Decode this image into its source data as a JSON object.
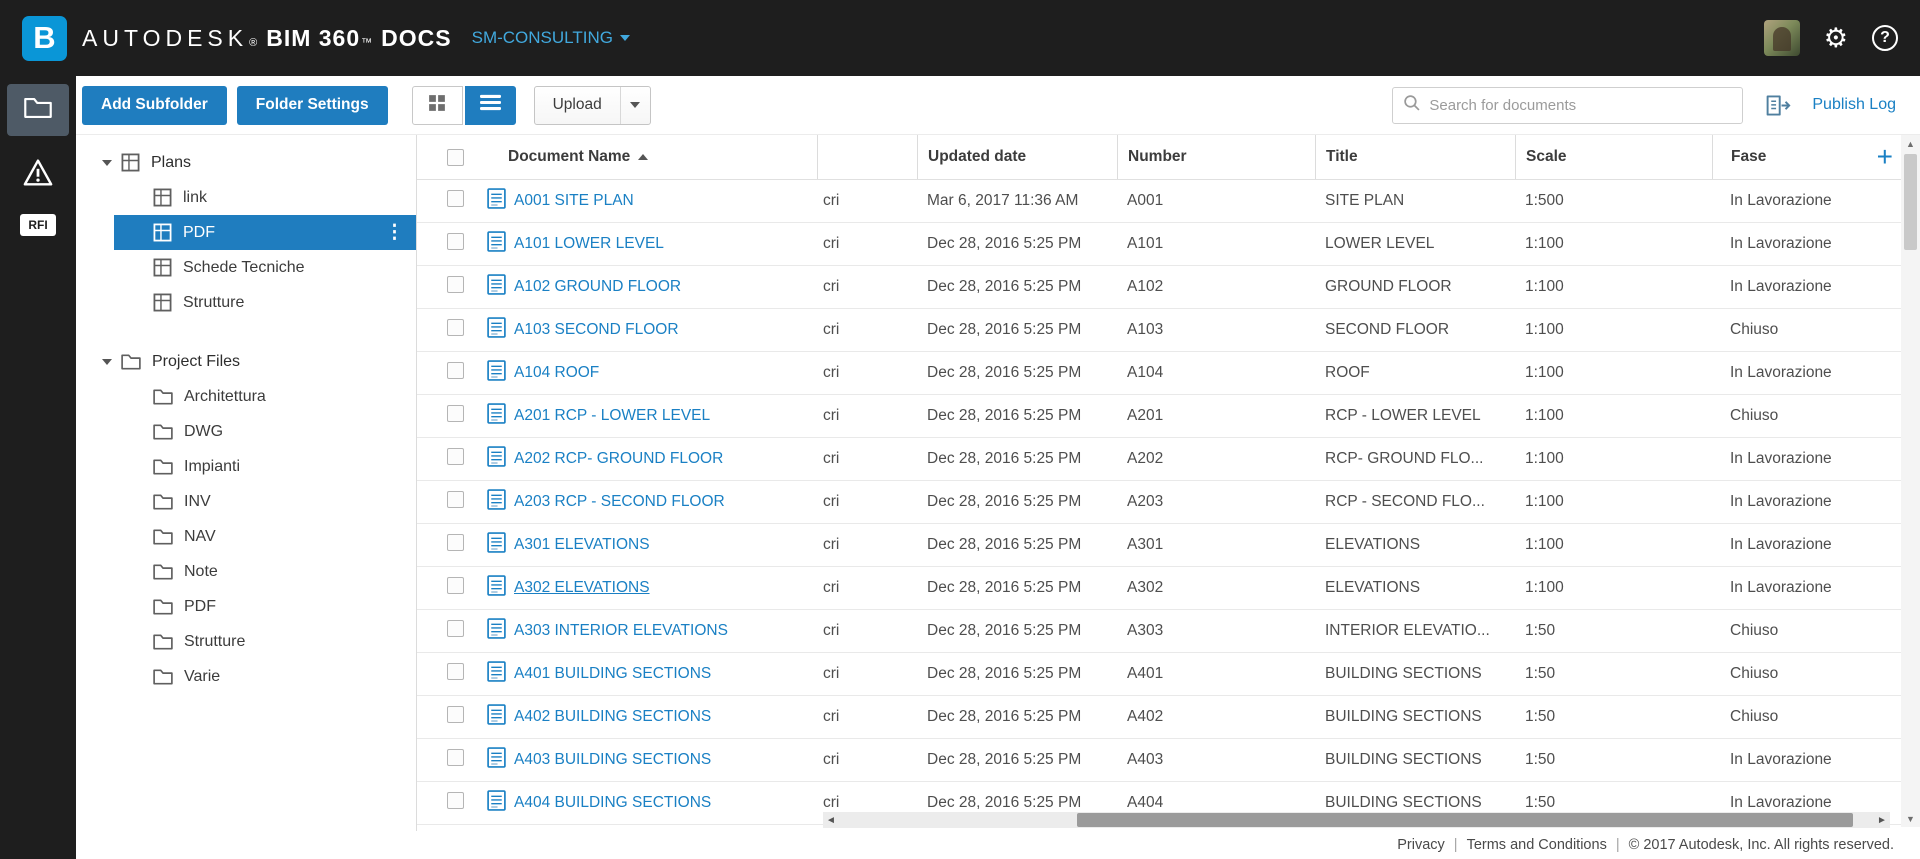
{
  "topbar": {
    "brand": {
      "logo_letter": "B",
      "autodesk": "AUTODESK",
      "reg": "®",
      "product": "BIM 360",
      "tm": "™",
      "docs": "DOCS"
    },
    "account_label": "SM-CONSULTING"
  },
  "rail": {
    "rfi_label": "RFI"
  },
  "toolbar": {
    "add_subfolder_label": "Add Subfolder",
    "folder_settings_label": "Folder Settings",
    "upload_label": "Upload",
    "search_placeholder": "Search for documents",
    "publish_log_label": "Publish Log"
  },
  "tree": {
    "sections": [
      {
        "label": "Plans",
        "icon": "sheet",
        "children": [
          {
            "label": "link"
          },
          {
            "label": "PDF",
            "selected": true
          },
          {
            "label": "Schede Tecniche"
          },
          {
            "label": "Strutture"
          }
        ]
      },
      {
        "label": "Project Files",
        "icon": "folder",
        "children": [
          {
            "label": "Architettura"
          },
          {
            "label": "DWG"
          },
          {
            "label": "Impianti"
          },
          {
            "label": "INV"
          },
          {
            "label": "NAV"
          },
          {
            "label": "Note"
          },
          {
            "label": "PDF"
          },
          {
            "label": "Strutture"
          },
          {
            "label": "Varie"
          }
        ]
      }
    ]
  },
  "table": {
    "header": {
      "name": "Document Name",
      "updated": "Updated date",
      "number": "Number",
      "title": "Title",
      "scale": "Scale",
      "fase": "Fase"
    },
    "rows": [
      {
        "name": "A001 SITE PLAN",
        "desc": "cri",
        "updated": "Mar 6, 2017 11:36 AM",
        "number": "A001",
        "title": "SITE PLAN",
        "scale": "1:500",
        "fase": "In Lavorazione"
      },
      {
        "name": "A101 LOWER LEVEL",
        "desc": "cri",
        "updated": "Dec 28, 2016 5:25 PM",
        "number": "A101",
        "title": "LOWER LEVEL",
        "scale": "1:100",
        "fase": "In Lavorazione"
      },
      {
        "name": "A102 GROUND FLOOR",
        "desc": "cri",
        "updated": "Dec 28, 2016 5:25 PM",
        "number": "A102",
        "title": "GROUND FLOOR",
        "scale": "1:100",
        "fase": "In Lavorazione"
      },
      {
        "name": "A103 SECOND FLOOR",
        "desc": "cri",
        "updated": "Dec 28, 2016 5:25 PM",
        "number": "A103",
        "title": "SECOND FLOOR",
        "scale": "1:100",
        "fase": "Chiuso"
      },
      {
        "name": "A104 ROOF",
        "desc": "cri",
        "updated": "Dec 28, 2016 5:25 PM",
        "number": "A104",
        "title": "ROOF",
        "scale": "1:100",
        "fase": "In Lavorazione"
      },
      {
        "name": "A201 RCP - LOWER LEVEL",
        "desc": "cri",
        "updated": "Dec 28, 2016 5:25 PM",
        "number": "A201",
        "title": "RCP - LOWER LEVEL",
        "scale": "1:100",
        "fase": "Chiuso"
      },
      {
        "name": "A202 RCP- GROUND FLOOR",
        "desc": "cri",
        "updated": "Dec 28, 2016 5:25 PM",
        "number": "A202",
        "title": "RCP- GROUND FLO...",
        "scale": "1:100",
        "fase": "In Lavorazione"
      },
      {
        "name": "A203 RCP - SECOND FLOOR",
        "desc": "cri",
        "updated": "Dec 28, 2016 5:25 PM",
        "number": "A203",
        "title": "RCP - SECOND FLO...",
        "scale": "1:100",
        "fase": "In Lavorazione"
      },
      {
        "name": "A301 ELEVATIONS",
        "desc": "cri",
        "updated": "Dec 28, 2016 5:25 PM",
        "number": "A301",
        "title": "ELEVATIONS",
        "scale": "1:100",
        "fase": "In Lavorazione"
      },
      {
        "name": "A302 ELEVATIONS",
        "desc": "cri",
        "updated": "Dec 28, 2016 5:25 PM",
        "number": "A302",
        "title": "ELEVATIONS",
        "scale": "1:100",
        "fase": "In Lavorazione",
        "underline": true
      },
      {
        "name": "A303 INTERIOR ELEVATIONS",
        "desc": "cri",
        "updated": "Dec 28, 2016 5:25 PM",
        "number": "A303",
        "title": "INTERIOR ELEVATIO...",
        "scale": "1:50",
        "fase": "Chiuso"
      },
      {
        "name": "A401 BUILDING SECTIONS",
        "desc": "cri",
        "updated": "Dec 28, 2016 5:25 PM",
        "number": "A401",
        "title": "BUILDING SECTIONS",
        "scale": "1:50",
        "fase": "Chiuso"
      },
      {
        "name": "A402 BUILDING SECTIONS",
        "desc": "cri",
        "updated": "Dec 28, 2016 5:25 PM",
        "number": "A402",
        "title": "BUILDING SECTIONS",
        "scale": "1:50",
        "fase": "Chiuso"
      },
      {
        "name": "A403 BUILDING SECTIONS",
        "desc": "cri",
        "updated": "Dec 28, 2016 5:25 PM",
        "number": "A403",
        "title": "BUILDING SECTIONS",
        "scale": "1:50",
        "fase": "In Lavorazione"
      },
      {
        "name": "A404 BUILDING SECTIONS",
        "desc": "cri",
        "updated": "Dec 28, 2016 5:25 PM",
        "number": "A404",
        "title": "BUILDING SECTIONS",
        "scale": "1:50",
        "fase": "In Lavorazione"
      }
    ]
  },
  "footer": {
    "privacy": "Privacy",
    "separator": "|",
    "terms": "Terms and Conditions",
    "copyright": "© 2017 Autodesk, Inc. All rights reserved."
  }
}
